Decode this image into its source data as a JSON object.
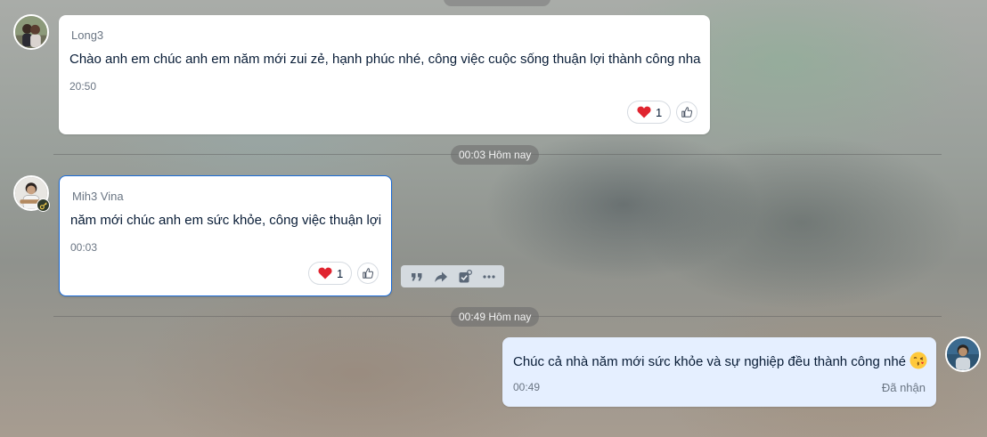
{
  "messages": [
    {
      "sender": "Long3",
      "text": "Chào anh em chúc anh em năm mới zui zẻ, hạnh phúc nhé, công việc cuộc sống thuận lợi thành công nha",
      "time": "20:50",
      "reaction": {
        "emoji": "heart",
        "count": "1"
      }
    },
    {
      "sender": "Mih3 Vina",
      "text": "năm mới chúc anh em sức khỏe, công việc thuận lợi",
      "time": "00:03",
      "reaction": {
        "emoji": "heart",
        "count": "1"
      }
    },
    {
      "sender": "",
      "text": "Chúc cả nhà năm mới sức khỏe và sự nghiệp đều thành công nhé",
      "emoji": "kissing-face-emoji",
      "time": "00:49",
      "status": "Đã nhận"
    }
  ],
  "dividers": [
    {
      "label": "00:03 Hôm nay"
    },
    {
      "label": "00:49 Hôm nay"
    }
  ],
  "action_bar": [
    "quote-icon",
    "forward-icon",
    "task-icon",
    "more-icon"
  ],
  "colors": {
    "accent": "#1a6bd8",
    "my_bubble": "#e5efff",
    "heart": "#e0242f"
  }
}
